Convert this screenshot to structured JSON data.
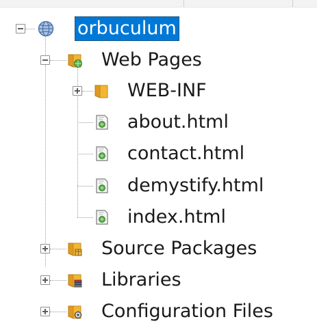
{
  "tree": {
    "root": {
      "label": "orbuculum",
      "icon": "globe-icon",
      "expanded": true,
      "selected": true
    },
    "web_pages": {
      "label": "Web Pages",
      "icon": "web-folder-icon",
      "expanded": true,
      "children": [
        {
          "label": "WEB-INF",
          "icon": "folder-icon",
          "expanded": false
        },
        {
          "label": "about.html",
          "icon": "html-file-icon"
        },
        {
          "label": "contact.html",
          "icon": "html-file-icon"
        },
        {
          "label": "demystify.html",
          "icon": "html-file-icon"
        },
        {
          "label": "index.html",
          "icon": "html-file-icon"
        }
      ]
    },
    "source_packages": {
      "label": "Source Packages",
      "icon": "source-packages-icon",
      "expanded": false
    },
    "libraries": {
      "label": "Libraries",
      "icon": "libraries-icon",
      "expanded": false
    },
    "configuration_files": {
      "label": "Configuration Files",
      "icon": "configuration-files-icon",
      "expanded": false
    }
  },
  "colors": {
    "selection": "#0078d7",
    "folder": "#f2b634",
    "guide_lines": "#9a9a9a"
  }
}
